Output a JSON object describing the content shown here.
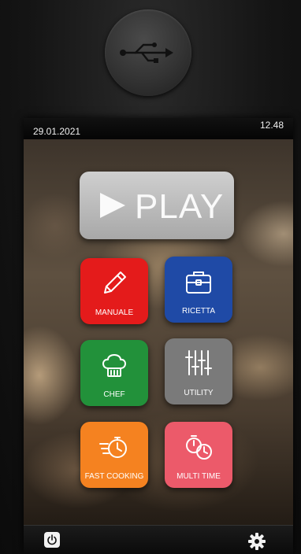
{
  "status": {
    "date": "29.01.2021",
    "time": "12.48"
  },
  "device": {
    "usb_icon": "usb-icon"
  },
  "play": {
    "label": "PLAY",
    "icon": "play-icon",
    "color": "#b9b9b9"
  },
  "tiles": [
    {
      "label": "MANUALE",
      "icon": "pencil-icon",
      "color": "#e41b1b"
    },
    {
      "label": "RICETTA",
      "icon": "briefcase-icon",
      "color": "#1f4aa6"
    },
    {
      "label": "CHEF",
      "icon": "chef-hat-icon",
      "color": "#22913a"
    },
    {
      "label": "UTILITY",
      "icon": "sliders-icon",
      "color": "#7a7a7a"
    },
    {
      "label": "FAST COOKING",
      "icon": "fast-timer-icon",
      "color": "#f58220"
    },
    {
      "label": "MULTI TIME",
      "icon": "multi-timer-icon",
      "color": "#ec5a6a"
    }
  ],
  "bottom_bar": {
    "power_icon": "power-icon",
    "settings_icon": "gear-icon"
  }
}
